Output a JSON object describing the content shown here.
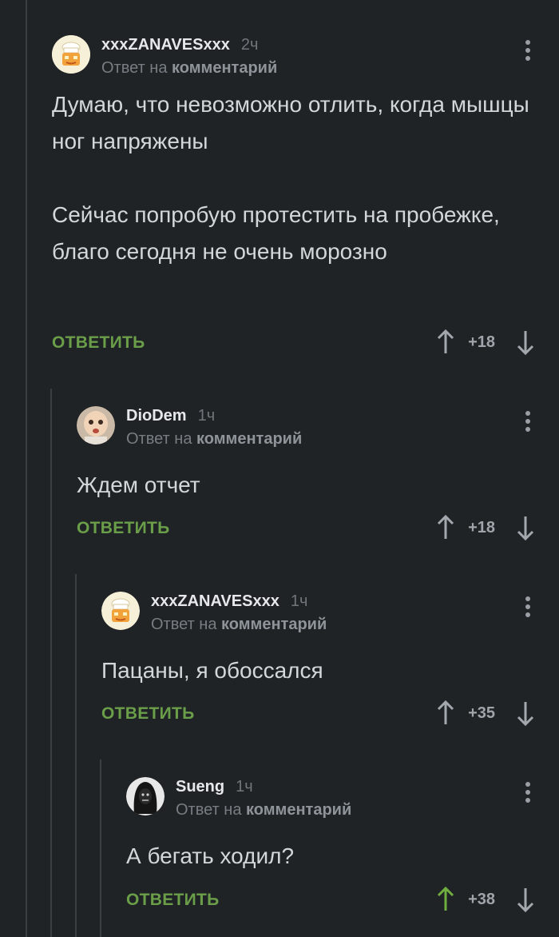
{
  "comments": [
    {
      "author": "xxxZANAVESxxx",
      "time": "2ч",
      "reply_prefix": "Ответ на",
      "reply_target": "комментарий",
      "paragraphs": [
        "Думаю, что невозможно отлить, когда мышцы ног напряжены",
        "Сейчас попробую протестить на пробежке, благо сегодня не очень морозно"
      ],
      "reply_label": "ОТВЕТИТЬ",
      "rating": "+18",
      "avatar": "chef-avatar",
      "upvoted": false
    },
    {
      "author": "DioDem",
      "time": "1ч",
      "reply_prefix": "Ответ на",
      "reply_target": "комментарий",
      "paragraphs": [
        "Ждем отчет"
      ],
      "reply_label": "ОТВЕТИТЬ",
      "rating": "+18",
      "avatar": "baby-avatar",
      "upvoted": false
    },
    {
      "author": "xxxZANAVESxxx",
      "time": "1ч",
      "reply_prefix": "Ответ на",
      "reply_target": "комментарий",
      "paragraphs": [
        "Пацаны, я обоссался"
      ],
      "reply_label": "ОТВЕТИТЬ",
      "rating": "+35",
      "avatar": "chef-avatar",
      "upvoted": false
    },
    {
      "author": "Sueng",
      "time": "1ч",
      "reply_prefix": "Ответ на",
      "reply_target": "комментарий",
      "paragraphs": [
        "А бегать ходил?"
      ],
      "reply_label": "ОТВЕТИТЬ",
      "rating": "+38",
      "avatar": "dark-figure-avatar",
      "upvoted": true
    }
  ],
  "colors": {
    "background": "#1f2326",
    "accent_green": "#6b9e49",
    "upvoted_arrow": "#6fae3f",
    "arrow_default": "#a2a8ad"
  }
}
